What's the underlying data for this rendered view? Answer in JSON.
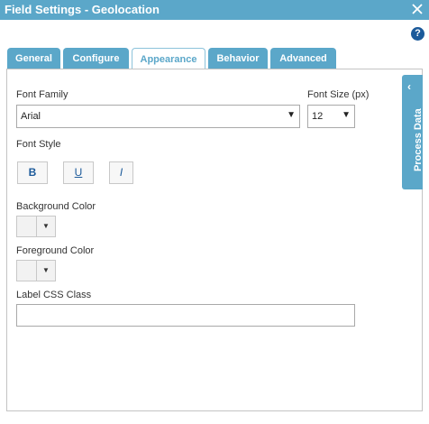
{
  "dialog": {
    "title": "Field Settings - Geolocation",
    "close_icon": "close-icon",
    "help_label": "?"
  },
  "tabs": [
    {
      "label": "General",
      "active": false
    },
    {
      "label": "Configure",
      "active": false
    },
    {
      "label": "Appearance",
      "active": true
    },
    {
      "label": "Behavior",
      "active": false
    },
    {
      "label": "Advanced",
      "active": false
    }
  ],
  "form": {
    "font_family_label": "Font Family",
    "font_family_value": "Arial",
    "font_size_label": "Font Size (px)",
    "font_size_value": "12",
    "font_style_label": "Font Style",
    "bold_label": "B",
    "underline_label": "U",
    "italic_label": "I",
    "background_color_label": "Background Color",
    "foreground_color_label": "Foreground Color",
    "label_css_class_label": "Label CSS Class",
    "label_css_class_value": ""
  },
  "side_panel": {
    "label": "Process Data",
    "chevron": "‹"
  },
  "colors": {
    "accent": "#5ba7c9",
    "help_icon": "#1c5a9a"
  }
}
